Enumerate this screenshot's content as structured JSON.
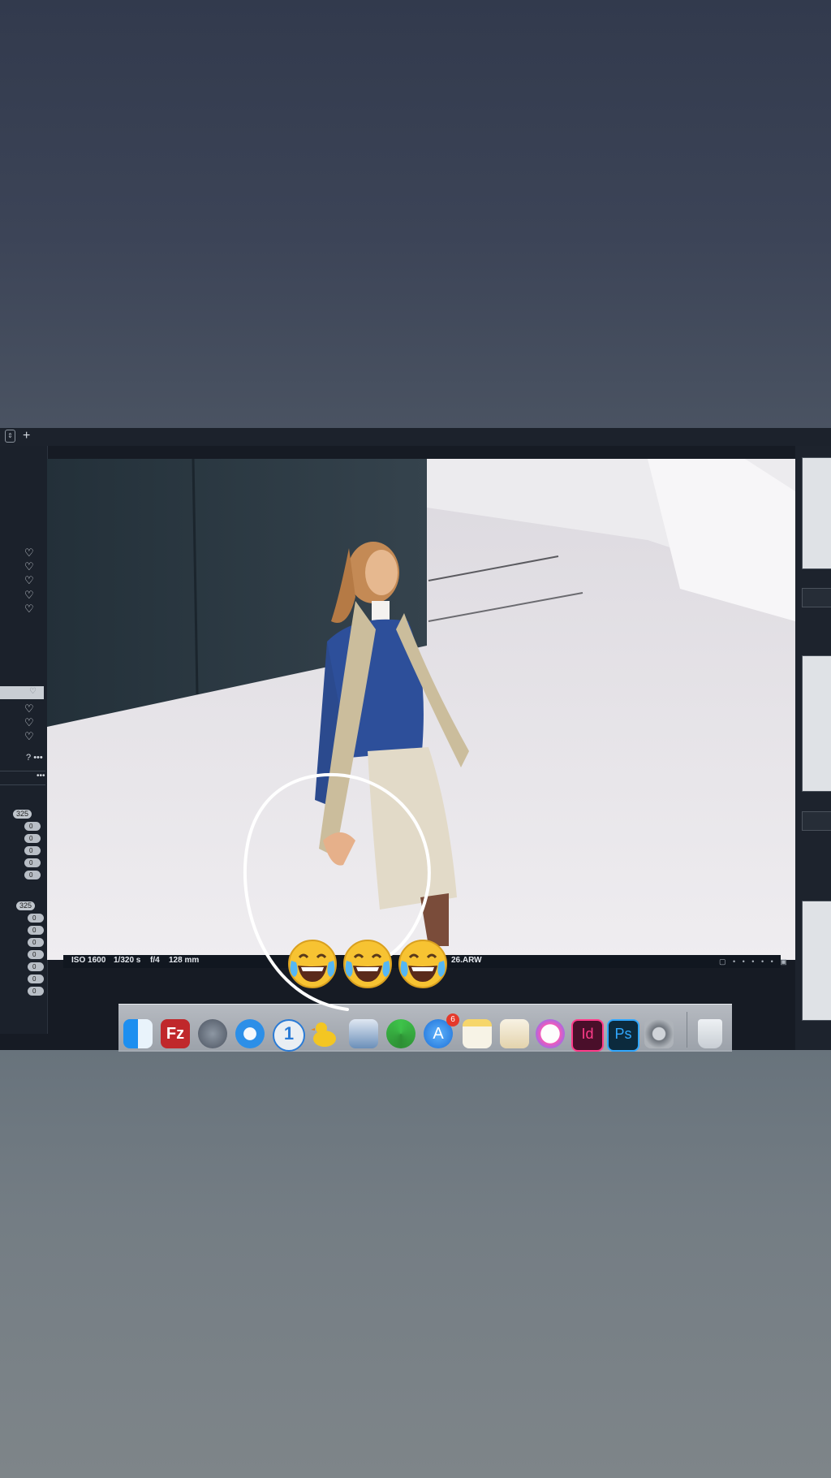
{
  "toolbar": {
    "plus_icon": "+",
    "stepper_icon": "⇕"
  },
  "left_panel": {
    "hearts": [
      "♡",
      "♡",
      "♡",
      "♡",
      "♡",
      "♡",
      "♡",
      "♡",
      "♡"
    ],
    "question_label": "?",
    "more_label": "•••",
    "field_more": "•••",
    "group1": {
      "first": "325",
      "rest": [
        "0",
        "0",
        "0",
        "0",
        "0"
      ]
    },
    "group2": {
      "first": "325",
      "rest": [
        "0",
        "0",
        "0",
        "0",
        "0",
        "0",
        "0"
      ]
    }
  },
  "meta": {
    "iso": "ISO 1600",
    "shutter": "1/320 s",
    "aperture": "f/4",
    "focal": "128 mm",
    "filename": "26.ARW"
  },
  "dock": {
    "badge": "6",
    "apps": [
      "finder",
      "filezilla",
      "launchpad",
      "safari",
      "1password",
      "cyberduck",
      "preview",
      "sync",
      "app-store",
      "notes",
      "pages",
      "itunes",
      "indesign",
      "photoshop",
      "system-preferences",
      "trash"
    ],
    "indesign_label": "Id",
    "photoshop_label": "Ps",
    "onepassword_label": "1",
    "filezilla_label": "Fz"
  },
  "emojis": [
    "😂",
    "😂",
    "😂"
  ],
  "colors": {
    "accent_red": "#e5392b",
    "indesign": "#ff3c8a",
    "photoshop": "#31a8ff"
  }
}
